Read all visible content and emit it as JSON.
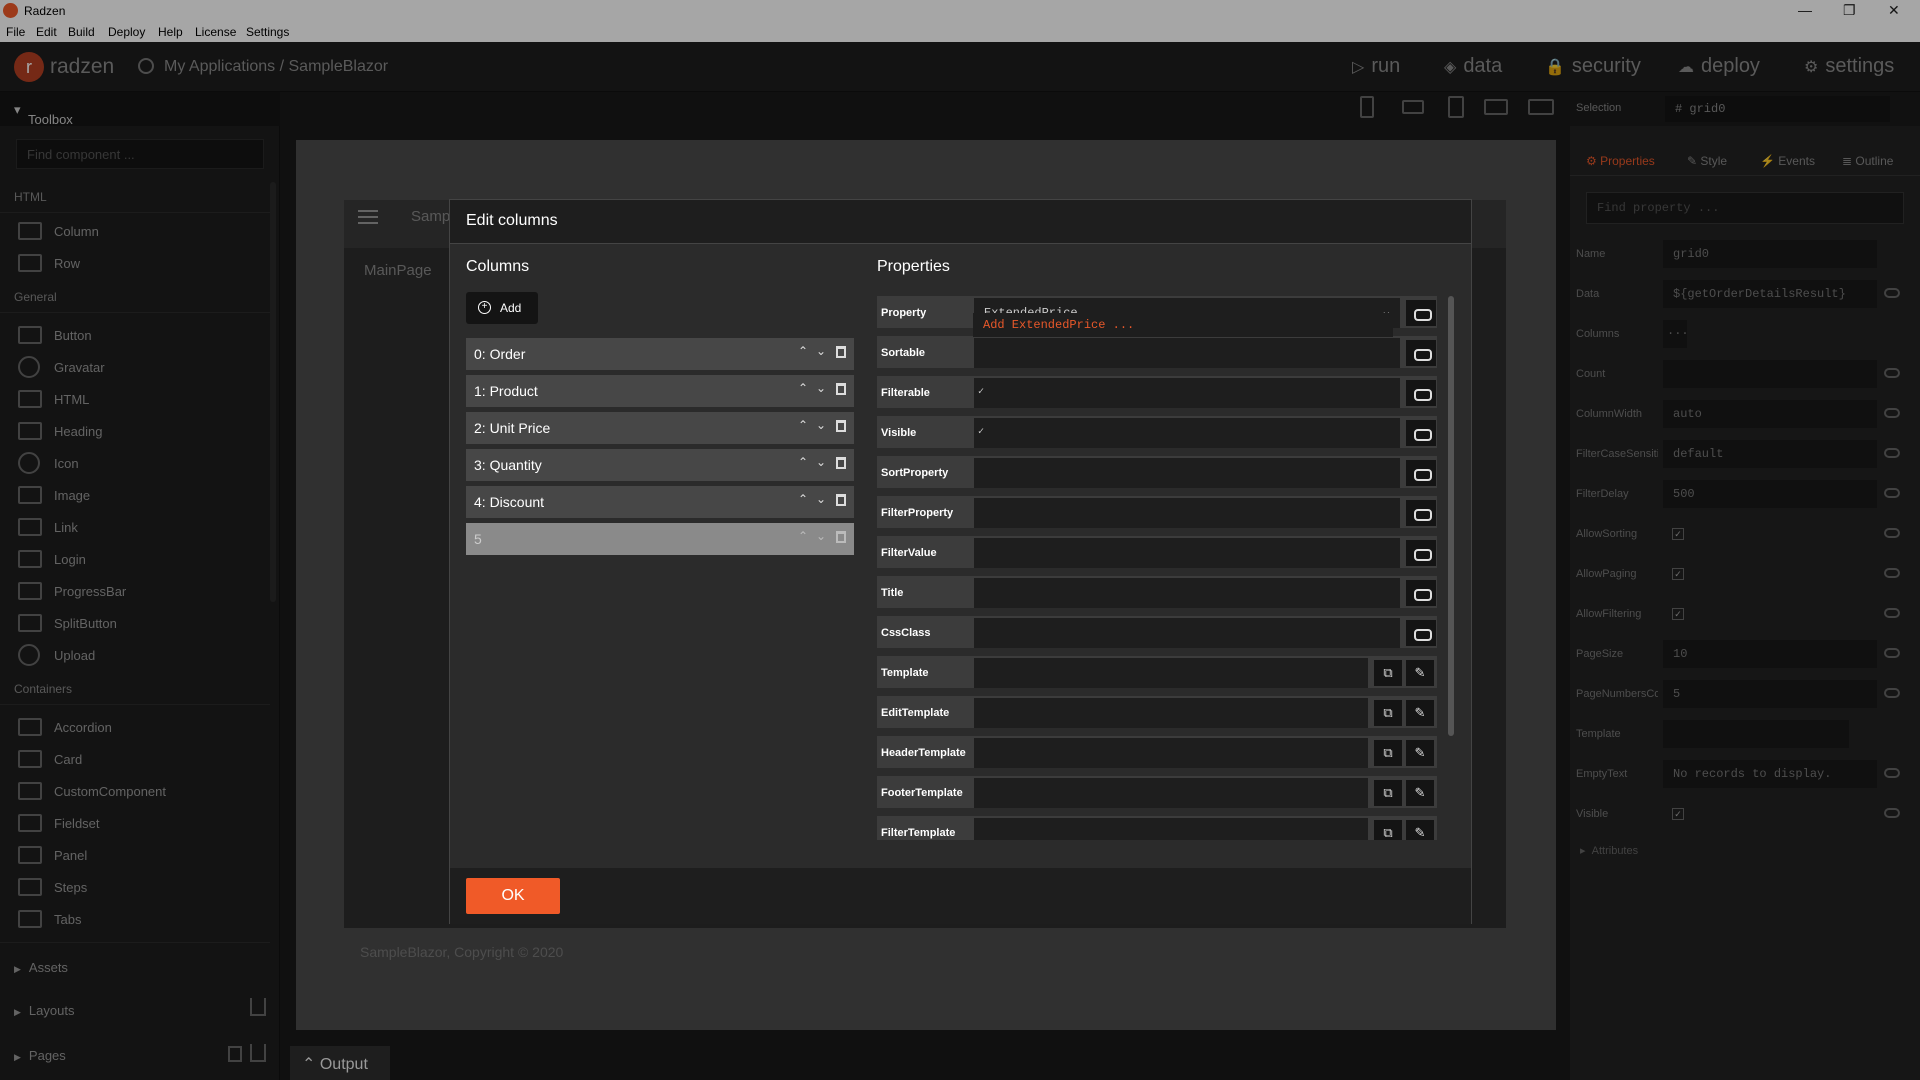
{
  "window": {
    "title": "Radzen"
  },
  "menubar": [
    "File",
    "Edit",
    "Build",
    "Deploy",
    "Help",
    "License",
    "Settings"
  ],
  "header": {
    "brand": "radzen",
    "breadcrumb": "My Applications / SampleBlazor",
    "nav": [
      {
        "label": "run",
        "icon": "▷"
      },
      {
        "label": "data",
        "icon": "◈"
      },
      {
        "label": "security",
        "icon": "🔒"
      },
      {
        "label": "deploy",
        "icon": "☁"
      },
      {
        "label": "settings",
        "icon": "⚙"
      }
    ]
  },
  "toolbox": {
    "title": "Toolbox",
    "search_placeholder": "Find component ...",
    "sections": {
      "html": "HTML",
      "general": "General",
      "containers": "Containers"
    },
    "html_items": [
      "Column",
      "Row"
    ],
    "general_items": [
      "Button",
      "Gravatar",
      "HTML",
      "Heading",
      "Icon",
      "Image",
      "Link",
      "Login",
      "ProgressBar",
      "SplitButton",
      "Upload"
    ],
    "container_items": [
      "Accordion",
      "Card",
      "CustomComponent",
      "Fieldset",
      "Panel",
      "Steps",
      "Tabs"
    ],
    "bottom": [
      "Assets",
      "Layouts",
      "Pages"
    ]
  },
  "canvas": {
    "app_name": "Samp",
    "page_link": "MainPage",
    "footer": "SampleBlazor, Copyright © 2020"
  },
  "right_panel": {
    "selection_label": "Selection",
    "selection_value": "grid0",
    "tabs": [
      "Properties",
      "Style",
      "Events",
      "Outline"
    ],
    "search_placeholder": "Find property ...",
    "props": [
      {
        "name": "Name",
        "value": "grid0"
      },
      {
        "name": "Data",
        "value": "${getOrderDetailsResult}"
      },
      {
        "name": "Columns",
        "value": "..."
      },
      {
        "name": "Count",
        "value": ""
      },
      {
        "name": "ColumnWidth",
        "value": "auto"
      },
      {
        "name": "FilterCaseSensiti...",
        "value": "default"
      },
      {
        "name": "FilterDelay",
        "value": "500"
      },
      {
        "name": "AllowSorting",
        "value": "✓"
      },
      {
        "name": "AllowPaging",
        "value": "✓"
      },
      {
        "name": "AllowFiltering",
        "value": "✓"
      },
      {
        "name": "PageSize",
        "value": "10"
      },
      {
        "name": "PageNumbersCo...",
        "value": "5"
      },
      {
        "name": "Template",
        "value": ""
      },
      {
        "name": "EmptyText",
        "value": "No records to display."
      },
      {
        "name": "Visible",
        "value": "✓"
      }
    ],
    "attributes": "Attributes"
  },
  "modal": {
    "title": "Edit columns",
    "columns_header": "Columns",
    "properties_header": "Properties",
    "add_label": "Add",
    "columns": [
      "0: Order",
      "1: Product",
      "2: Unit Price",
      "3: Quantity",
      "4: Discount",
      "5"
    ],
    "fields": [
      {
        "label": "Property",
        "value": "ExtendedPrice"
      },
      {
        "label": "Sortable",
        "value": ""
      },
      {
        "label": "Filterable",
        "value": "✓"
      },
      {
        "label": "Visible",
        "value": "✓"
      },
      {
        "label": "SortProperty",
        "value": ""
      },
      {
        "label": "FilterProperty",
        "value": ""
      },
      {
        "label": "FilterValue",
        "value": ""
      },
      {
        "label": "Title",
        "value": ""
      },
      {
        "label": "CssClass",
        "value": ""
      },
      {
        "label": "Template",
        "value": ""
      },
      {
        "label": "EditTemplate",
        "value": ""
      },
      {
        "label": "HeaderTemplate",
        "value": ""
      },
      {
        "label": "FooterTemplate",
        "value": ""
      },
      {
        "label": "FilterTemplate",
        "value": ""
      }
    ],
    "suggestion": "Add ExtendedPrice ...",
    "ok_label": "OK"
  },
  "output": {
    "label": "Output"
  }
}
